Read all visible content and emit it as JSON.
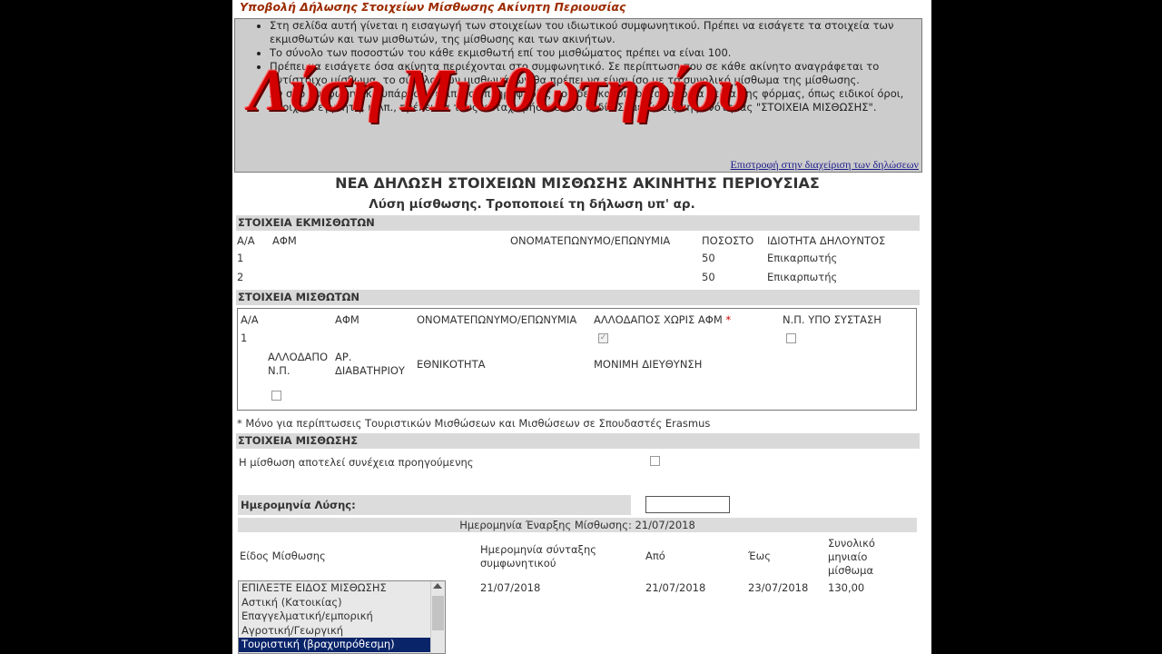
{
  "header": {
    "title": "Υποβολή Δήλωσης Στοιχείων Μίσθωσης Ακίνητη Περιουσίας"
  },
  "info": {
    "items": [
      "Στη σελίδα αυτή γίνεται η εισαγωγή των στοιχείων του ιδιωτικού συμφωνητικού. Πρέπει να εισάγετε τα στοιχεία των εκμισθωτών και των μισθωτών, της μίσθωσης και των ακινήτων.",
      "Το σύνολο των ποσοστών του κάθε εκμισθωτή επί του μισθώματος πρέπει να είναι 100.",
      "Πρέπει να εισάγετε όσα ακίνητα περιέχονται στο συμφωνητικό. Σε περίπτωση που σε κάθε ακίνητο αναγράφεται το αντίστοιχο μίσθωμα, το σύνολο των μισθωμάτων θα πρέπει να είναι ίσο με το συνολικό μίσθωμα της μίσθωσης.",
      "Αν στο συμφωνητικό υπάρχουν επιπλέον πληροφορίες που δεν καλύπτονται από τα πεδία της φόρμας, όπως ειδικοί όροι, στοιχεία εγγυητή, κ.λπ., πρέπει να τους καταχωρήσετε στο πεδίο Σημειώσεις της ενότητας \"ΣΤΟΙΧΕΙΑ ΜΙΣΘΩΣΗΣ\"."
    ],
    "back_link": "Επιστροφή στην διαχείριση των δηλώσεων"
  },
  "overlay": {
    "title": "Λύση Μισθωτηρίου"
  },
  "form": {
    "title": "ΝΕΑ ΔΗΛΩΣΗ ΣΤΟΙΧΕΙΩΝ ΜΙΣΘΩΣΗΣ ΑΚΙΝΗΤΗΣ ΠΕΡΙΟΥΣΙΑΣ",
    "subtitle": "Λύση μίσθωσης. Τροποποιεί τη δήλωση υπ' αρ."
  },
  "lessors": {
    "section": "ΣΤΟΙΧΕΙΑ ΕΚΜΙΣΘΩΤΩΝ",
    "headers": {
      "aa": "Α/Α",
      "afm": "ΑΦΜ",
      "name": "ΟΝΟΜΑΤΕΠΩΝΥΜΟ/ΕΠΩΝΥΜΙΑ",
      "pct": "ΠΟΣΟΣΤΟ",
      "role": "ΙΔΙΟΤΗΤΑ ΔΗΛΟΥΝΤΟΣ"
    },
    "rows": [
      {
        "aa": "1",
        "pct": "50",
        "role": "Επικαρπωτής"
      },
      {
        "aa": "2",
        "pct": "50",
        "role": "Επικαρπωτής"
      }
    ]
  },
  "lessees": {
    "section": "ΣΤΟΙΧΕΙΑ ΜΙΣΘΩΤΩΝ",
    "headers": {
      "aa": "Α/Α",
      "afm": "ΑΦΜ",
      "name": "ΟΝΟΜΑΤΕΠΩΝΥΜΟ/ΕΠΩΝΥΜΙΑ",
      "foreign": "ΑΛΛΟΔΑΠΟΣ ΧΩΡΙΣ ΑΦΜ",
      "asterisk": "*",
      "np": "Ν.Π. ΥΠΟ ΣΥΣΤΑΣΗ"
    },
    "row_aa": "1",
    "foreign_np_1": "ΑΛΛΟΔΑΠΟ",
    "foreign_np_2": "Ν.Π.",
    "passport_1": "ΑΡ.",
    "passport_2": "ΔΙΑΒΑΤΗΡΙΟΥ",
    "nationality": "ΕΘΝΙΚΟΤΗΤΑ",
    "address": "ΜΟΝΙΜΗ ΔΙΕΥΘΥΝΣΗ",
    "note": "* Μόνο για περίπτωσεις Τουριστικών Μισθώσεων και Μισθώσεων σε Σπουδαστές Erasmus"
  },
  "lease": {
    "section": "ΣΤΟΙΧΕΙΑ ΜΙΣΘΩΣΗΣ",
    "continuation": "Η μίσθωση αποτελεί συνέχεια προηγούμενης",
    "termination_label": "Ημερομηνία Λύσης:",
    "start_date": "Ημερομηνία Έναρξης Μίσθωσης: 21/07/2018",
    "type_label": "Είδος Μίσθωσης",
    "contract_date_1": "Ημερομηνία σύνταξης",
    "contract_date_2": "συμφωνητικού",
    "from_label": "Από",
    "to_label": "Έως",
    "total_1": "Συνολικό",
    "total_2": "μηνιαίο",
    "total_3": "μίσθωμα",
    "contract_date": "21/07/2018",
    "from_date": "21/07/2018",
    "to_date": "23/07/2018",
    "total": "130,00",
    "types": [
      "ΕΠΙΛΕΞΤΕ ΕΙΔΟΣ ΜΙΣΘΩΣΗΣ",
      "Αστική (Κατοικίας)",
      "Επαγγελματική/εμπορική",
      "Αγροτική/Γεωργική",
      "Τουριστική (βραχυπρόθεσμη)"
    ]
  }
}
